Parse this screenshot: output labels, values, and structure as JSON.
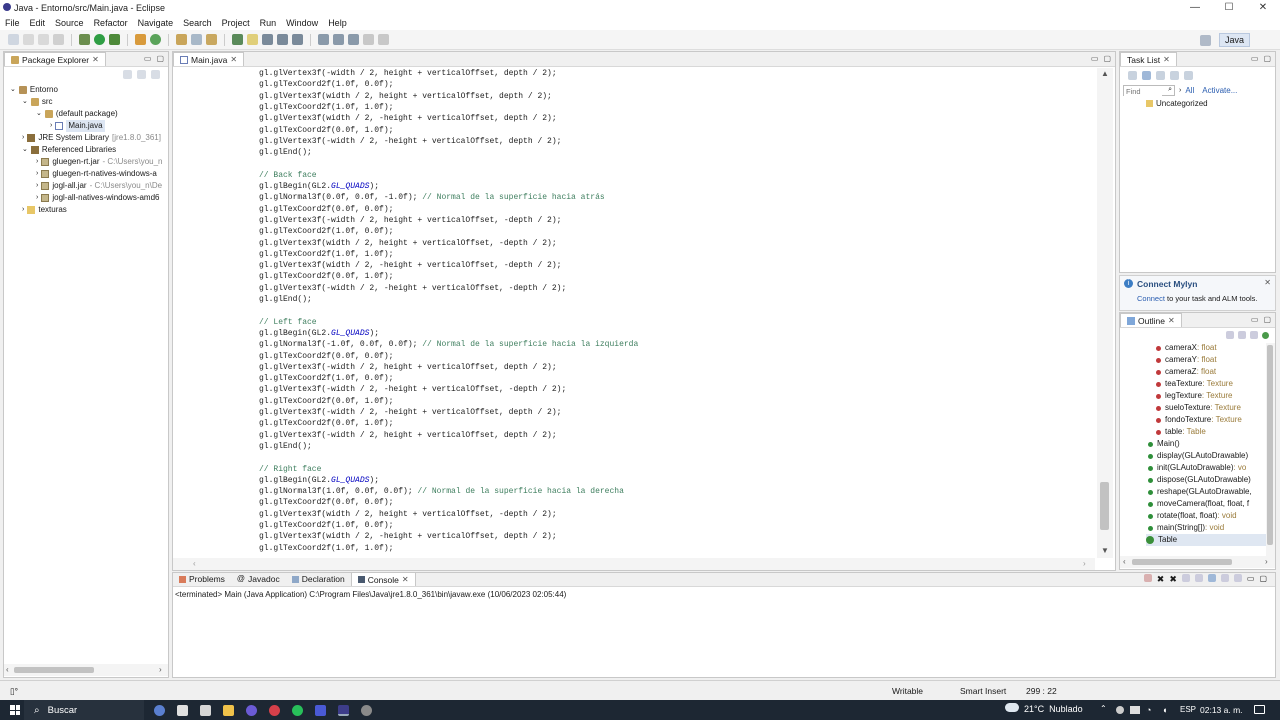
{
  "window": {
    "title": "Java - Entorno/src/Main.java - Eclipse",
    "min": "—",
    "max": "☐",
    "close": "✕"
  },
  "menu": [
    "File",
    "Edit",
    "Source",
    "Refactor",
    "Navigate",
    "Search",
    "Project",
    "Run",
    "Window",
    "Help"
  ],
  "perspective": {
    "label": "Java"
  },
  "package_explorer": {
    "title": "Package Explorer",
    "items": [
      {
        "label": "Entorno",
        "suffix": ""
      },
      {
        "label": "src",
        "suffix": ""
      },
      {
        "label": "(default package)",
        "suffix": ""
      },
      {
        "label": "Main.java",
        "suffix": ""
      },
      {
        "label": "JRE System Library",
        "suffix": " [jre1.8.0_361]"
      },
      {
        "label": "Referenced Libraries",
        "suffix": ""
      },
      {
        "label": "gluegen-rt.jar",
        "suffix": " - C:\\Users\\you_n"
      },
      {
        "label": "gluegen-rt-natives-windows-a",
        "suffix": ""
      },
      {
        "label": "jogl-all.jar",
        "suffix": " - C:\\Users\\you_n\\De"
      },
      {
        "label": "jogl-all-natives-windows-amd6",
        "suffix": ""
      },
      {
        "label": "texturas",
        "suffix": ""
      }
    ]
  },
  "editor": {
    "tab": "Main.java",
    "lines": [
      [
        {
          "t": "gl.glVertex3f(-width / 2, height + verticalOffset, depth / 2);"
        }
      ],
      [
        {
          "t": "gl.glTexCoord2f(1.0f, 0.0f);"
        }
      ],
      [
        {
          "t": "gl.glVertex3f(width / 2, height + verticalOffset, depth / 2);"
        }
      ],
      [
        {
          "t": "gl.glTexCoord2f(1.0f, 1.0f);"
        }
      ],
      [
        {
          "t": "gl.glVertex3f(width / 2, -height + verticalOffset, depth / 2);"
        }
      ],
      [
        {
          "t": "gl.glTexCoord2f(0.0f, 1.0f);"
        }
      ],
      [
        {
          "t": "gl.glVertex3f(-width / 2, -height + verticalOffset, depth / 2);"
        }
      ],
      [
        {
          "t": "gl.glEnd();"
        }
      ],
      [
        {
          "t": ""
        }
      ],
      [
        {
          "t": "// Back face",
          "c": "cmt"
        }
      ],
      [
        {
          "t": "gl.glBegin(GL2."
        },
        {
          "t": "GL_QUADS",
          "c": "ital"
        },
        {
          "t": ");"
        }
      ],
      [
        {
          "t": "gl.glNormal3f(0.0f, 0.0f, -1.0f); "
        },
        {
          "t": "// Normal de la superficie hacia atrás",
          "c": "cmt"
        }
      ],
      [
        {
          "t": "gl.glTexCoord2f(0.0f, 0.0f);"
        }
      ],
      [
        {
          "t": "gl.glVertex3f(-width / 2, height + verticalOffset, -depth / 2);"
        }
      ],
      [
        {
          "t": "gl.glTexCoord2f(1.0f, 0.0f);"
        }
      ],
      [
        {
          "t": "gl.glVertex3f(width / 2, height + verticalOffset, -depth / 2);"
        }
      ],
      [
        {
          "t": "gl.glTexCoord2f(1.0f, 1.0f);"
        }
      ],
      [
        {
          "t": "gl.glVertex3f(width / 2, -height + verticalOffset, -depth / 2);"
        }
      ],
      [
        {
          "t": "gl.glTexCoord2f(0.0f, 1.0f);"
        }
      ],
      [
        {
          "t": "gl.glVertex3f(-width / 2, -height + verticalOffset, -depth / 2);"
        }
      ],
      [
        {
          "t": "gl.glEnd();"
        }
      ],
      [
        {
          "t": ""
        }
      ],
      [
        {
          "t": "// Left face",
          "c": "cmt"
        }
      ],
      [
        {
          "t": "gl.glBegin(GL2."
        },
        {
          "t": "GL_QUADS",
          "c": "ital"
        },
        {
          "t": ");"
        }
      ],
      [
        {
          "t": "gl.glNormal3f(-1.0f, 0.0f, 0.0f); "
        },
        {
          "t": "// Normal de la superficie hacia la izquierda",
          "c": "cmt"
        }
      ],
      [
        {
          "t": "gl.glTexCoord2f(0.0f, 0.0f);"
        }
      ],
      [
        {
          "t": "gl.glVertex3f(-width / 2, height + verticalOffset, depth / 2);"
        }
      ],
      [
        {
          "t": "gl.glTexCoord2f(1.0f, 0.0f);"
        }
      ],
      [
        {
          "t": "gl.glVertex3f(-width / 2, -height + verticalOffset, -depth / 2);"
        }
      ],
      [
        {
          "t": "gl.glTexCoord2f(0.0f, 1.0f);"
        }
      ],
      [
        {
          "t": "gl.glVertex3f(-width / 2, -height + verticalOffset, depth / 2);"
        }
      ],
      [
        {
          "t": "gl.glTexCoord2f(0.0f, 1.0f);"
        }
      ],
      [
        {
          "t": "gl.glVertex3f(-width / 2, height + verticalOffset, depth / 2);"
        }
      ],
      [
        {
          "t": "gl.glEnd();"
        }
      ],
      [
        {
          "t": ""
        }
      ],
      [
        {
          "t": "// Right face",
          "c": "cmt"
        }
      ],
      [
        {
          "t": "gl.glBegin(GL2."
        },
        {
          "t": "GL_QUADS",
          "c": "ital"
        },
        {
          "t": ");"
        }
      ],
      [
        {
          "t": "gl.glNormal3f(1.0f, 0.0f, 0.0f); "
        },
        {
          "t": "// Normal de la superficie hacia la derecha",
          "c": "cmt"
        }
      ],
      [
        {
          "t": "gl.glTexCoord2f(0.0f, 0.0f);"
        }
      ],
      [
        {
          "t": "gl.glVertex3f(width / 2, height + verticalOffset, -depth / 2);"
        }
      ],
      [
        {
          "t": "gl.glTexCoord2f(1.0f, 0.0f);"
        }
      ],
      [
        {
          "t": "gl.glVertex3f(width / 2, -height + verticalOffset, depth / 2);"
        }
      ],
      [
        {
          "t": "gl.glTexCoord2f(1.0f, 1.0f);"
        }
      ]
    ]
  },
  "task_list": {
    "title": "Task List",
    "find_placeholder": "Find",
    "all": "All",
    "activate": "Activate...",
    "uncategorized": "Uncategorized"
  },
  "mylyn": {
    "title": "Connect Mylyn",
    "link": "Connect",
    "text": " to your task and ALM tools."
  },
  "outline": {
    "title": "Outline",
    "items": [
      {
        "name": "cameraX",
        "type": " : float",
        "kind": "field"
      },
      {
        "name": "cameraY",
        "type": " : float",
        "kind": "field"
      },
      {
        "name": "cameraZ",
        "type": " : float",
        "kind": "field"
      },
      {
        "name": "teaTexture",
        "type": " : Texture",
        "kind": "field"
      },
      {
        "name": "legTexture",
        "type": " : Texture",
        "kind": "field"
      },
      {
        "name": "sueloTexture",
        "type": " : Texture",
        "kind": "field"
      },
      {
        "name": "fondoTexture",
        "type": " : Texture",
        "kind": "field"
      },
      {
        "name": "table",
        "type": " : Table",
        "kind": "field"
      },
      {
        "name": "Main()",
        "type": "",
        "kind": "ctor"
      },
      {
        "name": "display(GLAutoDrawable)",
        "type": "",
        "kind": "method"
      },
      {
        "name": "init(GLAutoDrawable)",
        "type": " : vo",
        "kind": "method"
      },
      {
        "name": "dispose(GLAutoDrawable)",
        "type": "",
        "kind": "method"
      },
      {
        "name": "reshape(GLAutoDrawable,",
        "type": "",
        "kind": "method"
      },
      {
        "name": "moveCamera(float, float, f",
        "type": "",
        "kind": "method"
      },
      {
        "name": "rotate(float, float)",
        "type": " : void",
        "kind": "method"
      },
      {
        "name": "main(String[])",
        "type": " : void",
        "kind": "static"
      },
      {
        "name": "Table",
        "type": "",
        "kind": "class"
      }
    ]
  },
  "console": {
    "tabs": [
      "Problems",
      "Javadoc",
      "Declaration",
      "Console"
    ],
    "active": "Console",
    "text": "<terminated> Main (Java Application) C:\\Program Files\\Java\\jre1.8.0_361\\bin\\javaw.exe (10/06/2023 02:05:44)"
  },
  "status": {
    "left": "▯°",
    "writable": "Writable",
    "insert": "Smart Insert",
    "position": "299 : 22"
  },
  "taskbar": {
    "search": "Buscar",
    "weather": "21°C  Nublado",
    "lang": "ESP",
    "time": "02:13 a. m."
  }
}
